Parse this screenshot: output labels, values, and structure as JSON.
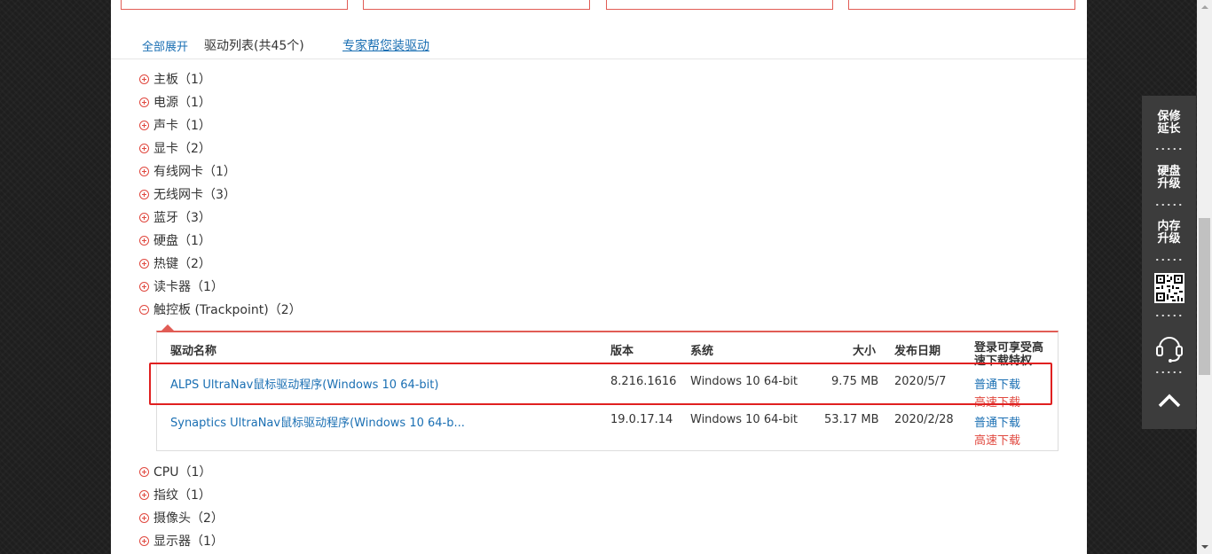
{
  "toolbar": {
    "expand_all": "全部展开",
    "list_title": "驱动列表(共45个)",
    "expert_link": "专家帮您装驱动"
  },
  "categories": [
    {
      "label": "主板（1）"
    },
    {
      "label": "电源（1）"
    },
    {
      "label": "声卡（1）"
    },
    {
      "label": "显卡（2）"
    },
    {
      "label": "有线网卡（1）"
    },
    {
      "label": "无线网卡（3）"
    },
    {
      "label": "蓝牙（3）"
    },
    {
      "label": "硬盘（1）"
    },
    {
      "label": "热键（2）"
    },
    {
      "label": "读卡器（1）"
    },
    {
      "label": "触控板 (Trackpoint)（2）",
      "expanded": true
    },
    {
      "label": "CPU（1）"
    },
    {
      "label": "指纹（1）"
    },
    {
      "label": "摄像头（2）"
    },
    {
      "label": "显示器（1）"
    }
  ],
  "table": {
    "headers": {
      "name": "驱动名称",
      "version": "版本",
      "system": "系统",
      "size": "大小",
      "date": "发布日期",
      "login": "登录可享受高速下载特权"
    },
    "rows": [
      {
        "name": "ALPS UltraNav鼠标驱动程序(Windows 10 64-bit)",
        "version": "8.216.1616",
        "system": "Windows 10 64-bit",
        "size": "9.75 MB",
        "date": "2020/5/7",
        "normal_download": "普通下载",
        "fast_download": "高速下载"
      },
      {
        "name": "Synaptics UltraNav鼠标驱动程序(Windows 10 64-b...",
        "version": "19.0.17.14",
        "system": "Windows 10 64-bit",
        "size": "53.17 MB",
        "date": "2020/2/28",
        "normal_download": "普通下载",
        "fast_download": "高速下载"
      }
    ]
  },
  "float_bar": {
    "warranty": "保修\n延长",
    "disk_upgrade": "硬盘\n升级",
    "memory_upgrade": "内存\n升级",
    "qr_icon": "qr-code-icon",
    "support_icon": "headset-icon",
    "top_icon": "chevron-up-icon"
  },
  "colors": {
    "accent_red": "#e15c55",
    "link_blue": "#1a6fb3",
    "fast_red": "#e0483f",
    "float_bg": "#3c3c3c"
  }
}
